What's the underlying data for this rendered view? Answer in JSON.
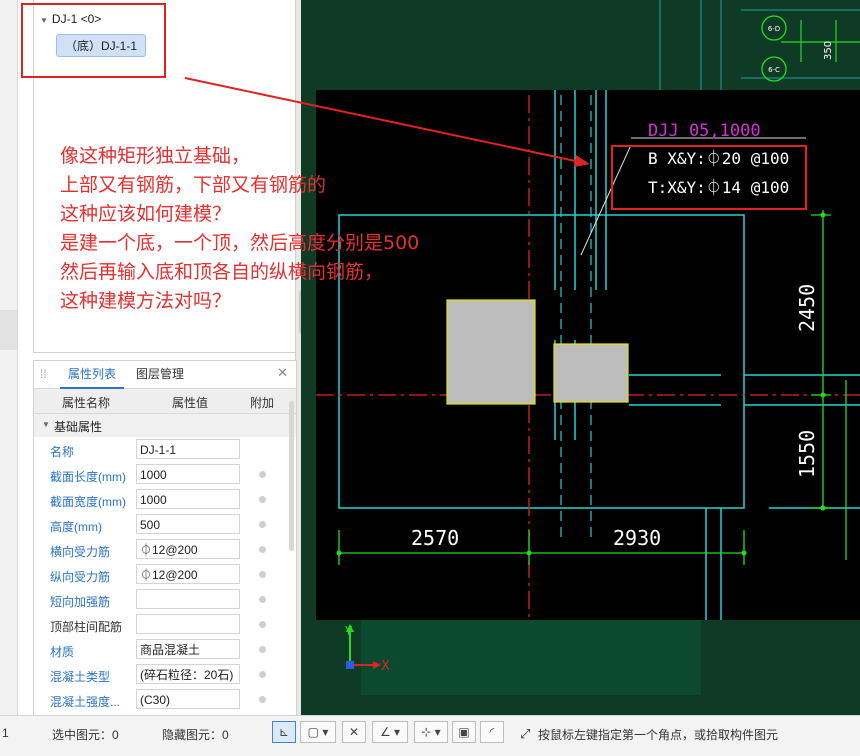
{
  "tree": {
    "root_label": "DJ-1 <0>",
    "child_label": "（底）DJ-1-1"
  },
  "props": {
    "tab_attributes": "属性列表",
    "tab_layers": "图层管理",
    "col_name": "属性名称",
    "col_value": "属性值",
    "col_extra": "附加",
    "section": "基础属性",
    "rows": [
      {
        "name": "名称",
        "value": "DJ-1-1"
      },
      {
        "name": "截面长度(mm)",
        "value": "1000"
      },
      {
        "name": "截面宽度(mm)",
        "value": "1000"
      },
      {
        "name": "高度(mm)",
        "value": "500"
      },
      {
        "name": "横向受力筋",
        "value": "⏀12@200"
      },
      {
        "name": "纵向受力筋",
        "value": "⏀12@200"
      },
      {
        "name": "短向加强筋",
        "value": ""
      },
      {
        "name": "顶部柱间配筋",
        "value": ""
      },
      {
        "name": "材质",
        "value": "商品混凝土"
      },
      {
        "name": "混凝土类型",
        "value": "(碎石粒径：20石)"
      },
      {
        "name": "混凝土强度...",
        "value": "(C30)"
      }
    ]
  },
  "drawing": {
    "label_djj": "DJJ 05,1000",
    "label_bottom_bar": "B X&Y:⏀20 @100",
    "label_top_bar": "T:X&Y:⏀14 @100",
    "dim_2570": "2570",
    "dim_2930": "2930",
    "dim_2450": "2450",
    "dim_1550": "1550",
    "dim_350": "350",
    "axis_6d": "6-D",
    "axis_6c": "6-C",
    "axis_x": "X",
    "axis_y": "Y"
  },
  "annotation": {
    "lines": [
      "像这种矩形独立基础，",
      "上部又有钢筋，下部又有钢筋的",
      "这种应该如何建模？",
      "是建一个底，一个顶，然后高度分别是500",
      "然后再输入底和顶各自的纵横向钢筋，",
      "这种建模方法对吗？"
    ]
  },
  "status": {
    "left_number": "1",
    "selected": "选中图元：0",
    "hidden": "隐藏图元：0",
    "hint": "按鼠标左键指定第一个角点，或拾取构件图元"
  },
  "colors": {
    "annotation_red": "#e02222",
    "drawing_bg": "#000000",
    "cad_cyan": "#22d3d3",
    "cad_green": "#22dd22",
    "cad_magenta": "#d62fd6",
    "highlight_blue": "#2b74c6"
  }
}
